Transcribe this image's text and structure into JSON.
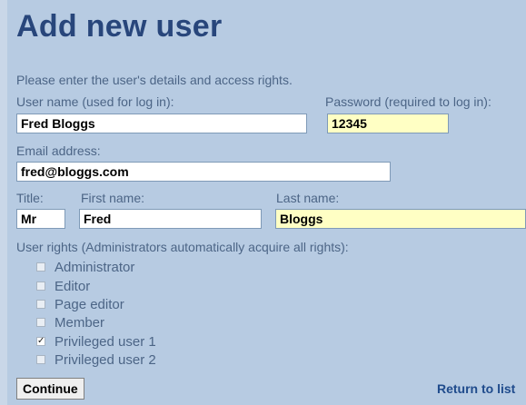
{
  "page": {
    "title": "Add new user",
    "intro": "Please enter the user's details and access rights."
  },
  "form": {
    "username": {
      "label": "User name (used for log in):",
      "value": "Fred Bloggs"
    },
    "password": {
      "label": "Password (required to log in):",
      "value": "12345"
    },
    "email": {
      "label": "Email address:",
      "value": "fred@bloggs.com"
    },
    "title": {
      "label": "Title:",
      "value": "Mr"
    },
    "first_name": {
      "label": "First name:",
      "value": "Fred"
    },
    "last_name": {
      "label": "Last name:",
      "value": "Bloggs"
    },
    "rights_label": "User rights (Administrators automatically acquire all rights):",
    "rights": [
      {
        "label": "Administrator",
        "checked": false
      },
      {
        "label": "Editor",
        "checked": false
      },
      {
        "label": "Page editor",
        "checked": false
      },
      {
        "label": "Member",
        "checked": false
      },
      {
        "label": "Privileged user 1",
        "checked": true
      },
      {
        "label": "Privileged user 2",
        "checked": false
      }
    ]
  },
  "actions": {
    "continue_label": "Continue",
    "return_label": "Return to list"
  },
  "colors": {
    "background": "#b7cbe2",
    "heading": "#28467b",
    "label": "#4c6586",
    "highlight_field": "#ffffc4",
    "link": "#1f4b8c"
  }
}
